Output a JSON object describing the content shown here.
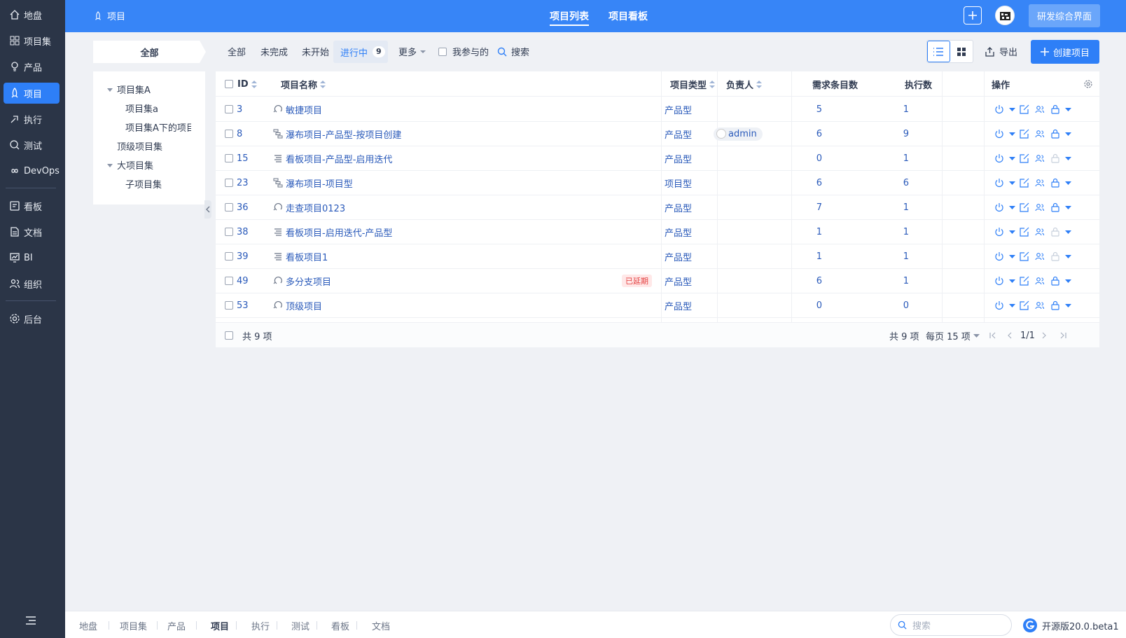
{
  "sidebar": {
    "items": [
      {
        "label": "地盘",
        "icon": "home-icon"
      },
      {
        "label": "项目集",
        "icon": "grid-icon"
      },
      {
        "label": "产品",
        "icon": "bulb-icon"
      },
      {
        "label": "项目",
        "icon": "rocket-icon",
        "active": true
      },
      {
        "label": "执行",
        "icon": "run-icon"
      },
      {
        "label": "测试",
        "icon": "bug-icon"
      },
      {
        "label": "DevOps",
        "icon": "infinity-icon"
      },
      {
        "label": "看板",
        "icon": "kanban-icon"
      },
      {
        "label": "文档",
        "icon": "doc-icon"
      },
      {
        "label": "BI",
        "icon": "chart-icon"
      },
      {
        "label": "组织",
        "icon": "people-icon"
      },
      {
        "label": "后台",
        "icon": "gear-icon"
      }
    ]
  },
  "header": {
    "breadcrumb": "项目",
    "tabs": [
      "项目列表",
      "项目看板"
    ],
    "active_tab": "项目列表",
    "rd_button": "研发综合界面"
  },
  "left_panel": {
    "all_label": "全部",
    "tree": [
      "项目集A",
      "项目集a",
      "项目集A下的项目",
      "顶级项目集",
      "大项目集",
      "子项目集"
    ]
  },
  "filters": {
    "tabs": [
      "全部",
      "未完成",
      "未开始"
    ],
    "active": "进行中",
    "active_count": "9",
    "more": "更多",
    "mine": "我参与的",
    "search": "搜索",
    "export": "导出",
    "create": "创建项目"
  },
  "table": {
    "columns": {
      "id": "ID",
      "name": "项目名称",
      "type": "项目类型",
      "pm": "负责人",
      "stories": "需求条目数",
      "executions": "执行数",
      "actions": "操作"
    },
    "rows": [
      {
        "id": "3",
        "name": "敏捷项目",
        "model": "scrum",
        "type": "产品型",
        "pm": "",
        "stories": "5",
        "executions": "1",
        "delayed": ""
      },
      {
        "id": "8",
        "name": "瀑布项目-产品型-按项目创建",
        "model": "waterfall",
        "type": "产品型",
        "pm": "admin",
        "stories": "6",
        "executions": "9",
        "delayed": ""
      },
      {
        "id": "15",
        "name": "看板项目-产品型-启用迭代",
        "model": "kanban",
        "type": "产品型",
        "pm": "",
        "stories": "0",
        "executions": "1",
        "delayed": ""
      },
      {
        "id": "23",
        "name": "瀑布项目-项目型",
        "model": "waterfall",
        "type": "项目型",
        "pm": "",
        "stories": "6",
        "executions": "6",
        "delayed": ""
      },
      {
        "id": "36",
        "name": "走查项目0123",
        "model": "scrum",
        "type": "产品型",
        "pm": "",
        "stories": "7",
        "executions": "1",
        "delayed": ""
      },
      {
        "id": "38",
        "name": "看板项目-启用迭代-产品型",
        "model": "kanban",
        "type": "产品型",
        "pm": "",
        "stories": "1",
        "executions": "1",
        "delayed": ""
      },
      {
        "id": "39",
        "name": "看板项目1",
        "model": "kanban",
        "type": "产品型",
        "pm": "",
        "stories": "1",
        "executions": "1",
        "delayed": ""
      },
      {
        "id": "49",
        "name": "多分支项目",
        "model": "scrum",
        "type": "产品型",
        "pm": "",
        "stories": "6",
        "executions": "1",
        "delayed": "已延期"
      },
      {
        "id": "53",
        "name": "顶级项目",
        "model": "scrum",
        "type": "产品型",
        "pm": "",
        "stories": "0",
        "executions": "0",
        "delayed": ""
      }
    ],
    "footer_total": "共 9 项",
    "pager_total": "共 9 项",
    "per_page": "每页 15 项",
    "page": "1/1"
  },
  "bottom": {
    "nav": [
      "地盘",
      "项目集",
      "产品",
      "项目",
      "执行",
      "测试",
      "看板",
      "文档"
    ],
    "active": "项目",
    "search_placeholder": "搜索",
    "version": "开源版20.0.beta1"
  },
  "colors": {
    "primary": "#2e7ff7",
    "sidebar": "#2b3547",
    "topbar": "#3785f7",
    "link": "#2a5aba"
  }
}
